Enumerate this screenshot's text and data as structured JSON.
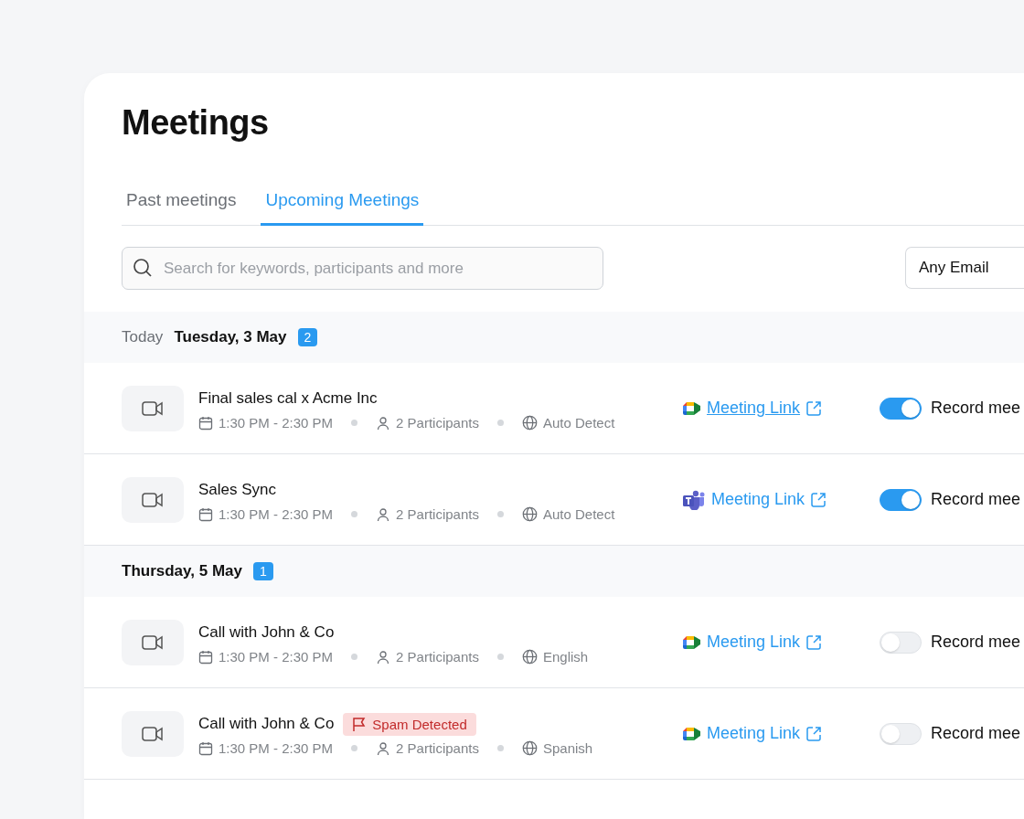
{
  "title": "Meetings",
  "tabs": [
    {
      "label": "Past meetings",
      "selected": false
    },
    {
      "label": "Upcoming Meetings",
      "selected": true
    }
  ],
  "search": {
    "placeholder": "Search for keywords, participants and more"
  },
  "email_filter": {
    "value": "Any Email"
  },
  "groups": [
    {
      "prefix": "Today",
      "date": "Tuesday, 3 May",
      "count": "2",
      "meetings": [
        {
          "title": "Final sales cal x Acme Inc",
          "time": "1:30 PM - 2:30 PM",
          "participants": "2 Participants",
          "language": "Auto Detect",
          "link": {
            "kind": "meet",
            "text": "Meeting Link",
            "underlined": true
          },
          "record": true,
          "record_label": "Record mee"
        },
        {
          "title": "Sales Sync",
          "time": "1:30 PM - 2:30 PM",
          "participants": "2 Participants",
          "language": "Auto Detect",
          "link": {
            "kind": "teams",
            "text": "Meeting Link",
            "underlined": false
          },
          "record": true,
          "record_label": "Record mee"
        }
      ]
    },
    {
      "date": "Thursday, 5 May",
      "count": "1",
      "meetings": [
        {
          "title": "Call with John & Co",
          "time": "1:30 PM - 2:30 PM",
          "participants": "2 Participants",
          "language": "English",
          "link": {
            "kind": "meet",
            "text": "Meeting Link",
            "underlined": false
          },
          "record": false,
          "record_label": "Record mee"
        },
        {
          "title": "Call with John & Co",
          "badge": "Spam Detected",
          "time": "1:30 PM - 2:30 PM",
          "participants": "2 Participants",
          "language": "Spanish",
          "link": {
            "kind": "meet",
            "text": "Meeting Link",
            "underlined": false
          },
          "record": false,
          "record_label": "Record mee"
        }
      ]
    }
  ]
}
